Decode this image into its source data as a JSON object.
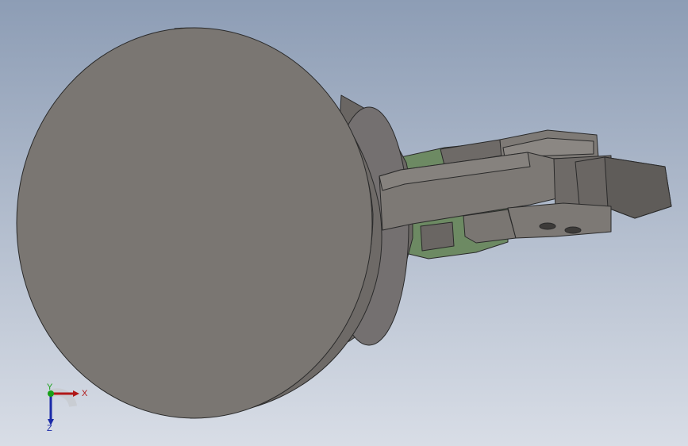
{
  "viewport": {
    "background_top": "#8d9db5",
    "background_bottom": "#d8dde6"
  },
  "model": {
    "part_gray": "#7a7672",
    "part_gray_dark": "#5e5b58",
    "part_gray_light": "#8b8783",
    "edge_color": "#2a2a2a",
    "plate_green": "#6d8a63"
  },
  "triad": {
    "x_label": "X",
    "y_label": "Y",
    "z_label": "Z",
    "x_color": "#b01818",
    "y_color": "#18a018",
    "z_color": "#1a2aa8"
  }
}
